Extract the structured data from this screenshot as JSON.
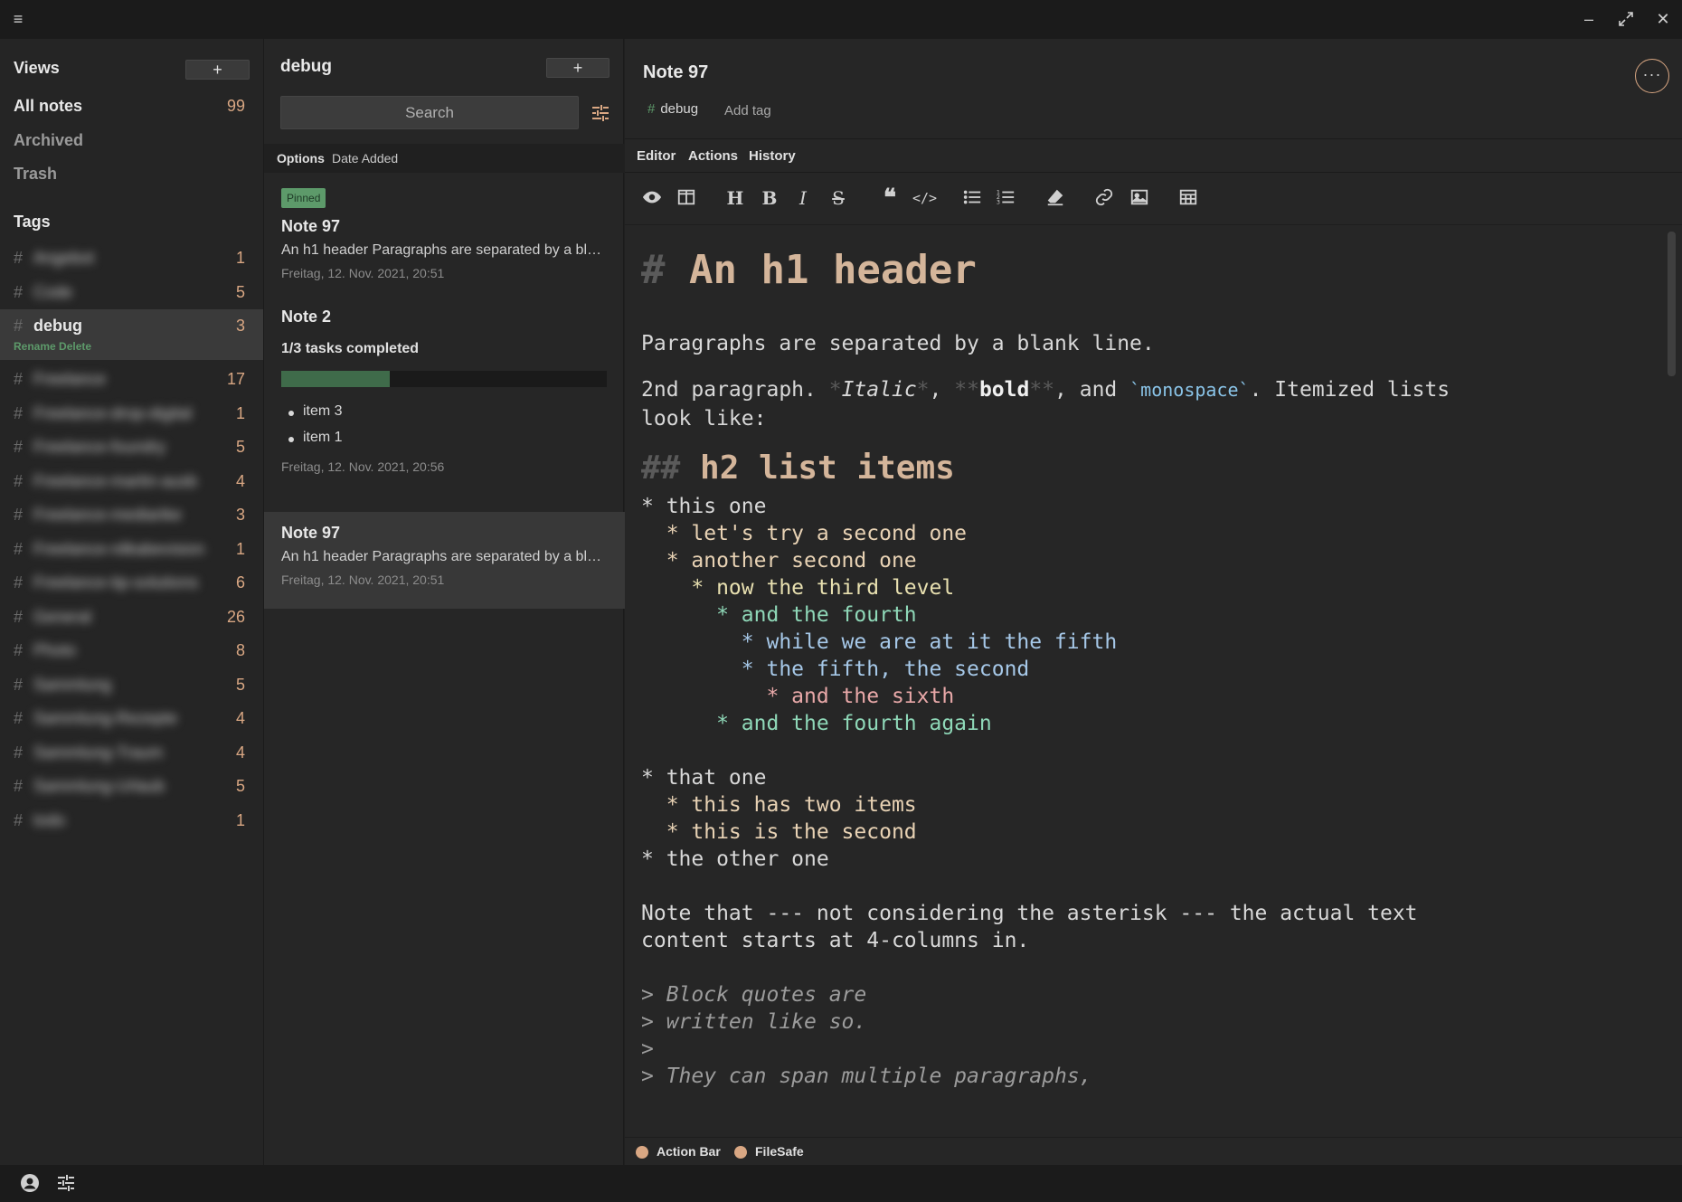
{
  "colors": {
    "accent": "#d9a783",
    "green": "#5d9a6a",
    "background": "#1f1f1f"
  },
  "titlebar": {
    "menu_icon": "hamburger-icon",
    "minimize_icon": "minimize-icon",
    "maximize_icon": "maximize-icon",
    "close_icon": "close-icon"
  },
  "sidebar": {
    "views_label": "Views",
    "add_label": "+",
    "views": [
      {
        "label": "All notes",
        "count": "99"
      },
      {
        "label": "Archived",
        "count": ""
      },
      {
        "label": "Trash",
        "count": ""
      }
    ],
    "tags_label": "Tags",
    "tags": [
      {
        "name": "Angebot",
        "count": "1",
        "blurred": true
      },
      {
        "name": "Code",
        "count": "5",
        "blurred": true
      },
      {
        "name": "debug",
        "count": "3",
        "blurred": false,
        "selected": true,
        "actions": "Rename Delete"
      },
      {
        "name": "Freelance",
        "count": "17",
        "blurred": true
      },
      {
        "name": "Freelance-drop-digital",
        "count": "1",
        "blurred": true
      },
      {
        "name": "Freelance-foundry",
        "count": "5",
        "blurred": true
      },
      {
        "name": "Freelance-martin-ausb",
        "count": "4",
        "blurred": true
      },
      {
        "name": "Freelance-mediarike",
        "count": "3",
        "blurred": true
      },
      {
        "name": "Freelance-nilkabevision",
        "count": "1",
        "blurred": true
      },
      {
        "name": "Freelance-tip-solutions",
        "count": "6",
        "blurred": true
      },
      {
        "name": "General",
        "count": "26",
        "blurred": true
      },
      {
        "name": "Photo",
        "count": "8",
        "blurred": true
      },
      {
        "name": "Sammlung",
        "count": "5",
        "blurred": true
      },
      {
        "name": "Sammlung-Rezepte",
        "count": "4",
        "blurred": true
      },
      {
        "name": "Sammlung-Traum",
        "count": "4",
        "blurred": true
      },
      {
        "name": "Sammlung-Urlaub",
        "count": "5",
        "blurred": true
      },
      {
        "name": "todo",
        "count": "1",
        "blurred": true
      }
    ]
  },
  "notes_list": {
    "title": "debug",
    "add_label": "+",
    "search_placeholder": "Search",
    "options_label": "Options",
    "sort_label": "Date Added",
    "notes": [
      {
        "pinned_label": "Pinned",
        "title": "Note 97",
        "preview": "An h1 header Paragraphs are separated by a blank line.",
        "date": "Freitag, 12. Nov. 2021, 20:51"
      },
      {
        "title": "Note 2",
        "tasks": "1/3 tasks completed",
        "progress": 0.333,
        "items": [
          "item 3",
          "item 1"
        ],
        "date": "Freitag, 12. Nov. 2021, 20:56"
      },
      {
        "title": "Note 97",
        "preview": "An h1 header Paragraphs are separated by a blank line.",
        "date": "Freitag, 12. Nov. 2021, 20:51",
        "selected": true
      }
    ]
  },
  "editor": {
    "title": "Note 97",
    "tag": "debug",
    "add_tag": "Add tag",
    "tabs": [
      "Editor",
      "Actions",
      "History"
    ],
    "content": {
      "h1_mark": "#",
      "h1": "An h1 header",
      "p1": "Paragraphs are separated by a blank line.",
      "p2_a": "2nd paragraph. ",
      "p2_it": "Italic",
      "p2_b": ", ",
      "p2_bold": "bold",
      "p2_c": ", and ",
      "p2_mono": "monospace",
      "p2_d": ". Itemized lists",
      "p2_line2": "look like:",
      "h2_mark": "##",
      "h2": "h2 list items",
      "list1": [
        "* this one",
        "  * let's try a second one",
        "  * another second one",
        "    * now the third level",
        "      * and the fourth",
        "        * while we are at it the fifth",
        "        * the fifth, the second",
        "          * and the sixth",
        "      * and the fourth again"
      ],
      "list2": [
        "* that one",
        "  * this has two items",
        "  * this is the second",
        "* the other one"
      ],
      "note1": "Note that --- not considering the asterisk --- the actual text",
      "note2": "content starts at 4-columns in.",
      "quote": [
        "> Block quotes are",
        "> written like so.",
        ">",
        "> They can span multiple paragraphs,"
      ]
    },
    "status": [
      "Action Bar",
      "FileSafe"
    ]
  }
}
